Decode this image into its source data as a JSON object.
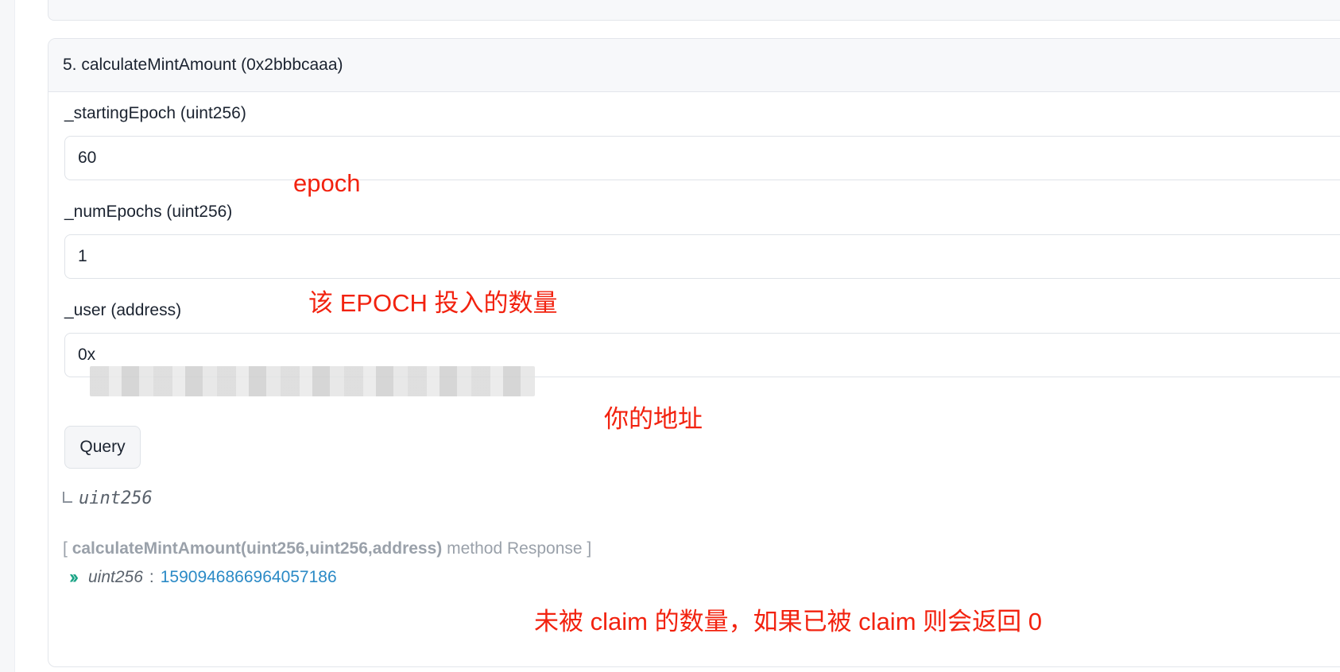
{
  "card": {
    "title": "5. calculateMintAmount (0x2bbbcaaa)"
  },
  "fields": [
    {
      "label": "_startingEpoch (uint256)",
      "value": "60"
    },
    {
      "label": "_numEpochs (uint256)",
      "value": "1"
    },
    {
      "label": "_user (address)",
      "value": "0x"
    }
  ],
  "query": {
    "label": "Query"
  },
  "output": {
    "return_type": "uint256",
    "response_open": "[",
    "response_signature": "calculateMintAmount(uint256,uint256,address)",
    "response_suffix": "method Response ]",
    "result_type": "uint256",
    "result_colon": ":",
    "result_value": "1590946866964057186"
  },
  "annotations": {
    "epoch": "epoch",
    "num_epochs": "该 EPOCH 投入的数量",
    "address": "你的地址",
    "result": "未被 claim 的数量，如果已被 claim 则会返回 0"
  },
  "colors": {
    "annotation": "#f2220f",
    "result_value": "#2b8ac6",
    "chevron": "#1ba486"
  }
}
